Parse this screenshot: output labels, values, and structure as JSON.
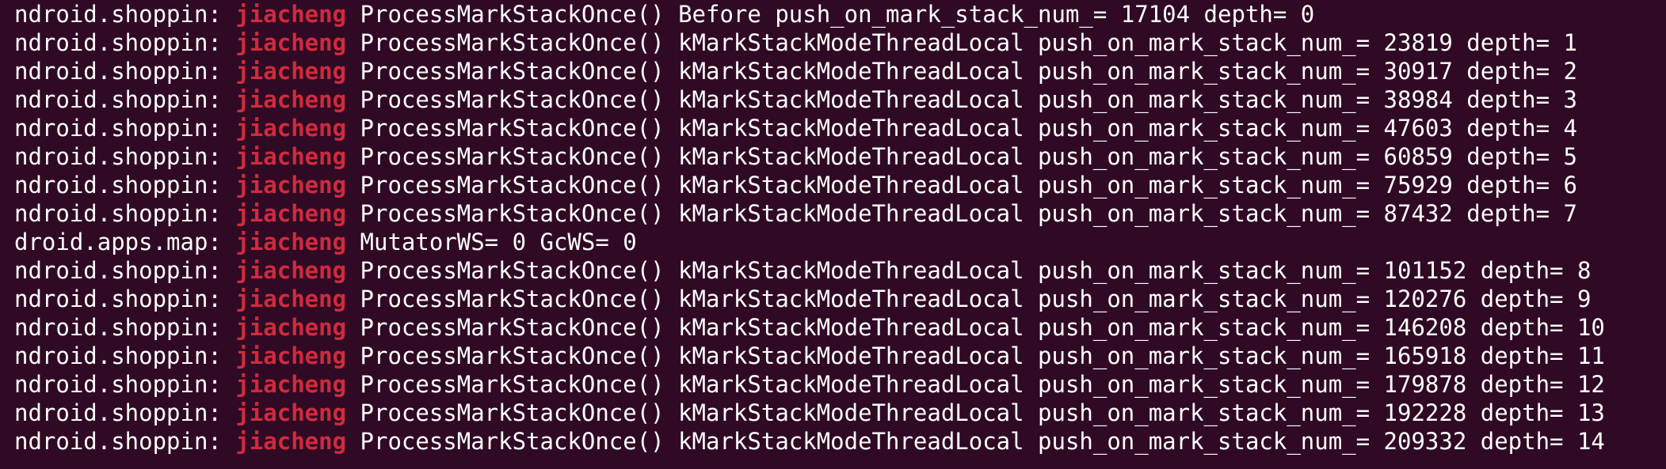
{
  "terminal": {
    "highlight_color": "#d02a3e",
    "background_color": "#300a24",
    "text_color": "#ffffff",
    "lines": [
      {
        "src": "ndroid.shoppin:",
        "tag": "jiacheng",
        "msg": "ProcessMarkStackOnce() Before push_on_mark_stack_num_= 17104 depth= 0"
      },
      {
        "src": "ndroid.shoppin:",
        "tag": "jiacheng",
        "msg": "ProcessMarkStackOnce() kMarkStackModeThreadLocal push_on_mark_stack_num_= 23819 depth= 1"
      },
      {
        "src": "ndroid.shoppin:",
        "tag": "jiacheng",
        "msg": "ProcessMarkStackOnce() kMarkStackModeThreadLocal push_on_mark_stack_num_= 30917 depth= 2"
      },
      {
        "src": "ndroid.shoppin:",
        "tag": "jiacheng",
        "msg": "ProcessMarkStackOnce() kMarkStackModeThreadLocal push_on_mark_stack_num_= 38984 depth= 3"
      },
      {
        "src": "ndroid.shoppin:",
        "tag": "jiacheng",
        "msg": "ProcessMarkStackOnce() kMarkStackModeThreadLocal push_on_mark_stack_num_= 47603 depth= 4"
      },
      {
        "src": "ndroid.shoppin:",
        "tag": "jiacheng",
        "msg": "ProcessMarkStackOnce() kMarkStackModeThreadLocal push_on_mark_stack_num_= 60859 depth= 5"
      },
      {
        "src": "ndroid.shoppin:",
        "tag": "jiacheng",
        "msg": "ProcessMarkStackOnce() kMarkStackModeThreadLocal push_on_mark_stack_num_= 75929 depth= 6"
      },
      {
        "src": "ndroid.shoppin:",
        "tag": "jiacheng",
        "msg": "ProcessMarkStackOnce() kMarkStackModeThreadLocal push_on_mark_stack_num_= 87432 depth= 7"
      },
      {
        "src": "droid.apps.map:",
        "tag": "jiacheng",
        "msg": "MutatorWS= 0 GcWS= 0"
      },
      {
        "src": "ndroid.shoppin:",
        "tag": "jiacheng",
        "msg": "ProcessMarkStackOnce() kMarkStackModeThreadLocal push_on_mark_stack_num_= 101152 depth= 8"
      },
      {
        "src": "ndroid.shoppin:",
        "tag": "jiacheng",
        "msg": "ProcessMarkStackOnce() kMarkStackModeThreadLocal push_on_mark_stack_num_= 120276 depth= 9"
      },
      {
        "src": "ndroid.shoppin:",
        "tag": "jiacheng",
        "msg": "ProcessMarkStackOnce() kMarkStackModeThreadLocal push_on_mark_stack_num_= 146208 depth= 10"
      },
      {
        "src": "ndroid.shoppin:",
        "tag": "jiacheng",
        "msg": "ProcessMarkStackOnce() kMarkStackModeThreadLocal push_on_mark_stack_num_= 165918 depth= 11"
      },
      {
        "src": "ndroid.shoppin:",
        "tag": "jiacheng",
        "msg": "ProcessMarkStackOnce() kMarkStackModeThreadLocal push_on_mark_stack_num_= 179878 depth= 12"
      },
      {
        "src": "ndroid.shoppin:",
        "tag": "jiacheng",
        "msg": "ProcessMarkStackOnce() kMarkStackModeThreadLocal push_on_mark_stack_num_= 192228 depth= 13"
      },
      {
        "src": "ndroid.shoppin:",
        "tag": "jiacheng",
        "msg": "ProcessMarkStackOnce() kMarkStackModeThreadLocal push_on_mark_stack_num_= 209332 depth= 14"
      }
    ]
  }
}
